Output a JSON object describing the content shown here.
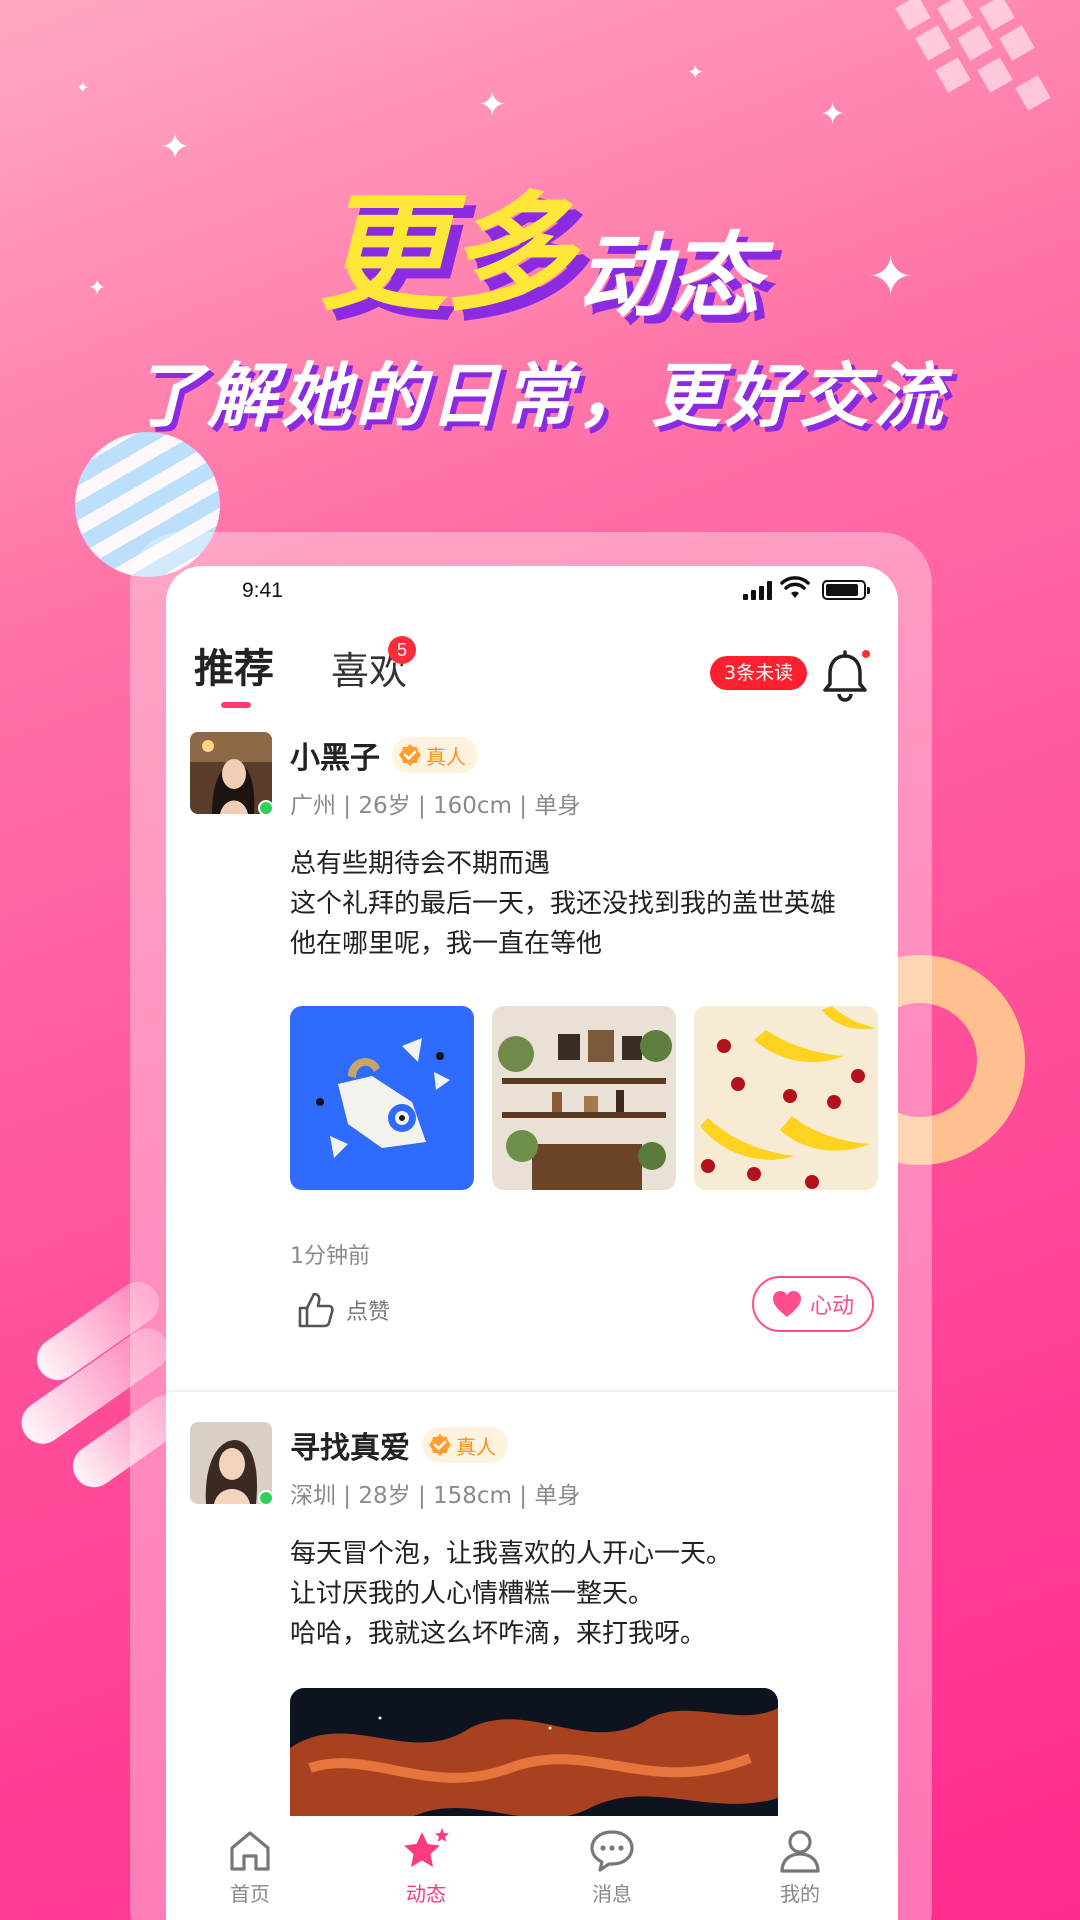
{
  "headline": {
    "big": "更多",
    "small": "动态"
  },
  "subline": "了解她的日常，更好交流",
  "status_bar": {
    "time": "9:41"
  },
  "tabs": {
    "recommend": "推荐",
    "like": "喜欢",
    "like_badge": "5",
    "unread": "3条未读"
  },
  "posts": [
    {
      "name": "小黑子",
      "real_label": "真人",
      "meta": "广州 | 26岁 | 160cm | 单身",
      "lines": [
        "总有些期待会不期而遇",
        "这个礼拜的最后一天，我还没找到我的盖世英雄",
        "他在哪里呢，我一直在等他"
      ],
      "time": "1分钟前",
      "like_label": "点赞",
      "heart_label": "心动"
    },
    {
      "name": "寻找真爱",
      "real_label": "真人",
      "meta": "深圳 | 28岁 | 158cm | 单身",
      "lines": [
        "每天冒个泡，让我喜欢的人开心一天。",
        "让讨厌我的人心情糟糕一整天。",
        "哈哈，我就这么坏咋滴，来打我呀。"
      ]
    }
  ],
  "bottom_nav": {
    "home": "首页",
    "feed": "动态",
    "messages": "消息",
    "mine": "我的",
    "active": "feed"
  },
  "colors": {
    "accent": "#ff3b7f",
    "headline_yellow": "#ffe739",
    "headline_shadow": "#8a2be2",
    "badge_red": "#ff1f2e",
    "online_green": "#2ed158"
  }
}
